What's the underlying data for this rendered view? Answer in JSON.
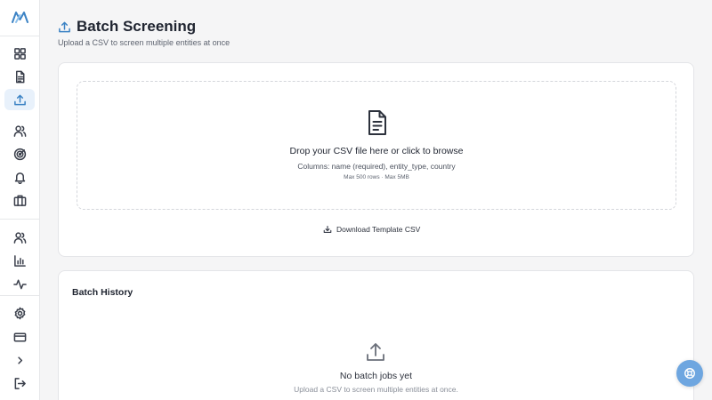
{
  "colors": {
    "accent": "#3b82c4",
    "active_bg": "#e8f1fb",
    "fab": "#6ea6e0",
    "background": "#f5f5f6"
  },
  "sidebar": {
    "logo": "brand-logo",
    "items": [
      {
        "icon": "dashboard-icon",
        "active": false
      },
      {
        "icon": "document-icon",
        "active": false
      },
      {
        "icon": "upload-icon",
        "active": true
      },
      {
        "icon": "users-icon",
        "active": false
      },
      {
        "icon": "radar-icon",
        "active": false
      },
      {
        "icon": "bell-icon",
        "active": false
      },
      {
        "icon": "briefcase-icon",
        "active": false
      },
      {
        "icon": "team-icon",
        "active": false
      },
      {
        "icon": "bar-chart-icon",
        "active": false
      },
      {
        "icon": "activity-icon",
        "active": false
      },
      {
        "icon": "gear-icon",
        "active": false
      },
      {
        "icon": "credit-card-icon",
        "active": false
      },
      {
        "icon": "chevron-right-icon",
        "active": false
      },
      {
        "icon": "logout-icon",
        "active": false
      }
    ]
  },
  "header": {
    "title": "Batch Screening",
    "subtitle": "Upload a CSV to screen multiple entities at once"
  },
  "upload": {
    "drop_title": "Drop your CSV file here or click to browse",
    "columns_hint": "Columns: name (required), entity_type, country",
    "limits": "Max 500 rows · Max 5MB",
    "download_label": "Download Template CSV"
  },
  "history": {
    "title": "Batch History",
    "empty_title": "No batch jobs yet",
    "empty_subtitle": "Upload a CSV to screen multiple entities at once."
  }
}
